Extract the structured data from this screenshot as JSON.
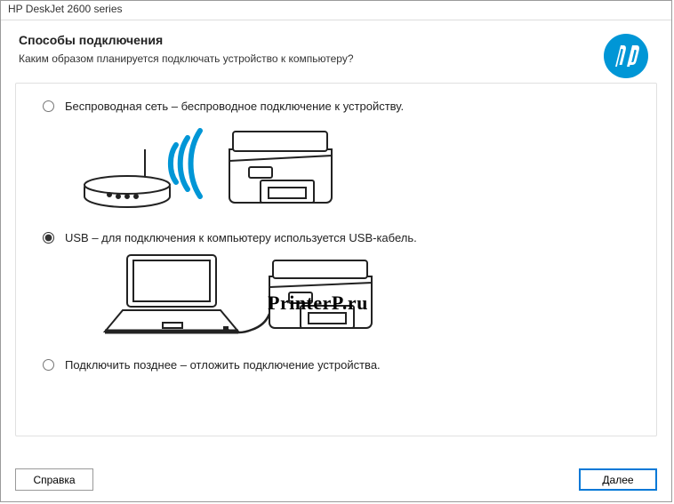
{
  "window": {
    "title": "HP DeskJet 2600 series"
  },
  "header": {
    "title": "Способы подключения",
    "subtitle": "Каким образом планируется подключать устройство к компьютеру?"
  },
  "options": {
    "wireless": {
      "label": "Беспроводная сеть – беспроводное подключение к устройству.",
      "selected": false
    },
    "usb": {
      "label": "USB – для подключения к компьютеру используется USB-кабель.",
      "selected": true
    },
    "later": {
      "label": "Подключить позднее – отложить подключение устройства.",
      "selected": false
    }
  },
  "watermark": "PrinterP.ru",
  "buttons": {
    "help": "Справка",
    "next": "Далее"
  },
  "logo": {
    "name": "hp-logo"
  }
}
